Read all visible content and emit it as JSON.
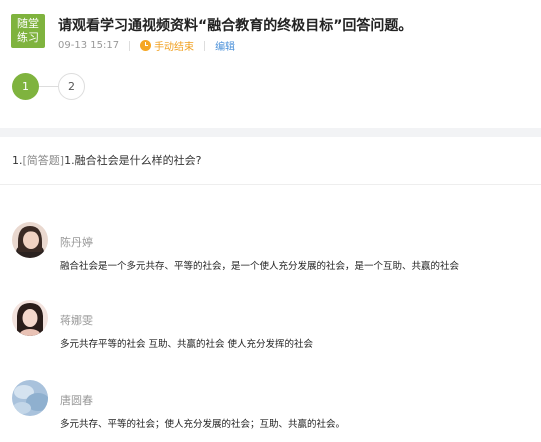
{
  "header": {
    "badge_line1": "随堂",
    "badge_line2": "练习",
    "title": "请观看学习通视频资料“融合教育的终极目标”回答问题。",
    "time": "09-13 15:17",
    "status": "手动结束",
    "edit_label": "编辑"
  },
  "steps": [
    "1",
    "2"
  ],
  "question": {
    "prefix": "1.",
    "type": "[简答题]",
    "text": "1.融合社会是什么样的社会?"
  },
  "answers": [
    {
      "name": "陈丹婷",
      "content": "融合社会是一个多元共存、平等的社会，是一个使人充分发展的社会，是一个互助、共赢的社会"
    },
    {
      "name": "蒋娜雯",
      "content": "多元共存平等的社会 互助、共赢的社会 使人充分发挥的社会"
    },
    {
      "name": "唐圆春",
      "content": "多元共存、平等的社会；使人充分发展的社会；互助、共赢的社会。"
    }
  ],
  "colors": {
    "accent_green": "#7fb33e",
    "status_orange": "#f0a020",
    "link_blue": "#4a90d9"
  }
}
